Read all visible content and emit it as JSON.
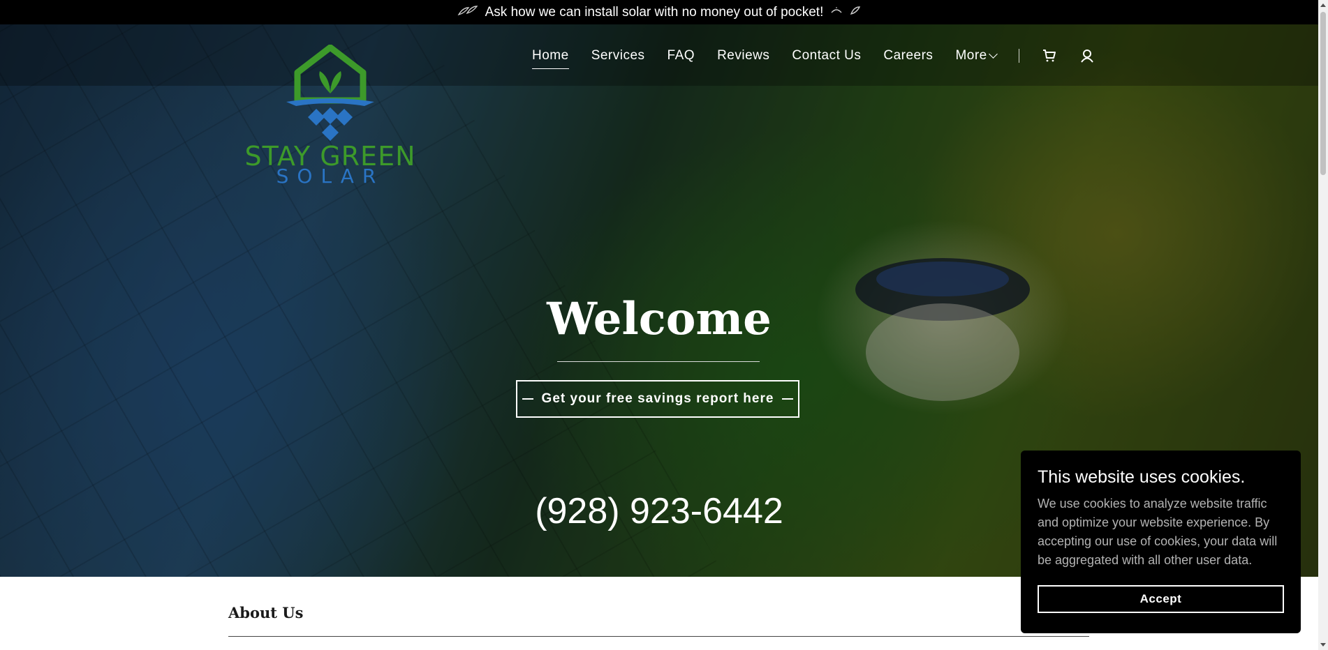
{
  "announcement": {
    "text": "Ask how we can install solar with no money out of pocket!"
  },
  "brand": {
    "line1": "STAY GREEN",
    "line2": "SOLAR",
    "colors": {
      "green": "#3d9a2a",
      "blue": "#2a74c4"
    }
  },
  "nav": {
    "items": [
      {
        "label": "Home",
        "active": true
      },
      {
        "label": "Services"
      },
      {
        "label": "FAQ"
      },
      {
        "label": "Reviews"
      },
      {
        "label": "Contact Us"
      },
      {
        "label": "Careers"
      },
      {
        "label": "More"
      }
    ],
    "icons": [
      "cart-icon",
      "account-icon"
    ]
  },
  "hero": {
    "title": "Welcome",
    "cta_label": "Get your free savings report here",
    "phone": "(928) 923-6442"
  },
  "about": {
    "title": "About Us"
  },
  "cookie": {
    "title": "This website uses cookies.",
    "body": "We use cookies to analyze website traffic and optimize your website experience. By accepting our use of cookies, your data will be aggregated with all other user data.",
    "accept_label": "Accept"
  }
}
